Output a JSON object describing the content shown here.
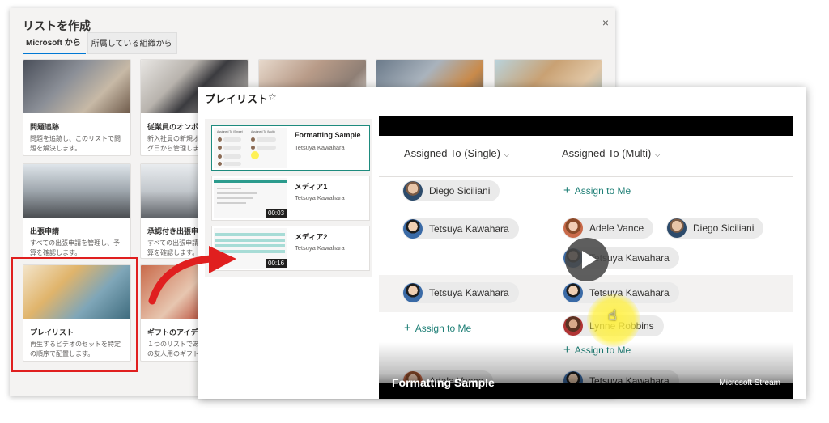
{
  "back_panel": {
    "title": "リストを作成",
    "close_glyph": "×",
    "tabs": [
      {
        "label": "Microsoft から",
        "active": true
      },
      {
        "label": "所属している組織から",
        "active": false
      }
    ],
    "templates": [
      {
        "name": "問題追跡",
        "desc": "問題を追跡し、このリストで問題を解決します。"
      },
      {
        "name": "従業員のオンボーディング",
        "desc": "新入社員の新規オンボーディング日から管理します。"
      },
      {
        "name": "",
        "desc": ""
      },
      {
        "name": "",
        "desc": ""
      },
      {
        "name": "",
        "desc": ""
      },
      {
        "name": "出張申請",
        "desc": "すべての出張申請を管理し、予算を確認します。"
      },
      {
        "name": "承認付き出張申請",
        "desc": "すべての出張申請を管理し、予算を確認します。"
      },
      {
        "name": "プレイリスト",
        "desc": "再生するビデオのセットを特定の順序で配置します。"
      },
      {
        "name": "ギフトのアイデア",
        "desc": "１つのリストであなたとあなたの友人用のギフト計画を"
      }
    ]
  },
  "front_panel": {
    "title": "プレイリスト",
    "star_glyph": "☆",
    "playlist": [
      {
        "title": "Formatting Sample",
        "author": "Tetsuya Kawahara",
        "duration": ""
      },
      {
        "title": "メディア1",
        "author": "Tetsuya Kawahara",
        "duration": "00:03"
      },
      {
        "title": "メディア2",
        "author": "Tetsuya Kawahara",
        "duration": "00:16"
      }
    ],
    "thumb1_labels": {
      "left": "Assigned To (Single)",
      "right": "Assigned To (Multi)"
    },
    "video": {
      "col_single": "Assigned To (Single)",
      "col_multi": "Assigned To (Multi)",
      "chevron": "⌵",
      "people": {
        "diego": "Diego Siciliani",
        "tetsuya": "Tetsuya Kawahara",
        "adele": "Adele Vance",
        "lynne": "Lynne Robbins"
      },
      "assign_label": "Assign to Me",
      "plus": "+",
      "title": "Formatting Sample",
      "brand": "Microsoft Stream"
    }
  },
  "colors": {
    "accent_teal": "#1e7f76",
    "highlight_red": "#e01f1f",
    "tab_blue": "#0078d4",
    "cursor_yellow": "#fff03c"
  }
}
